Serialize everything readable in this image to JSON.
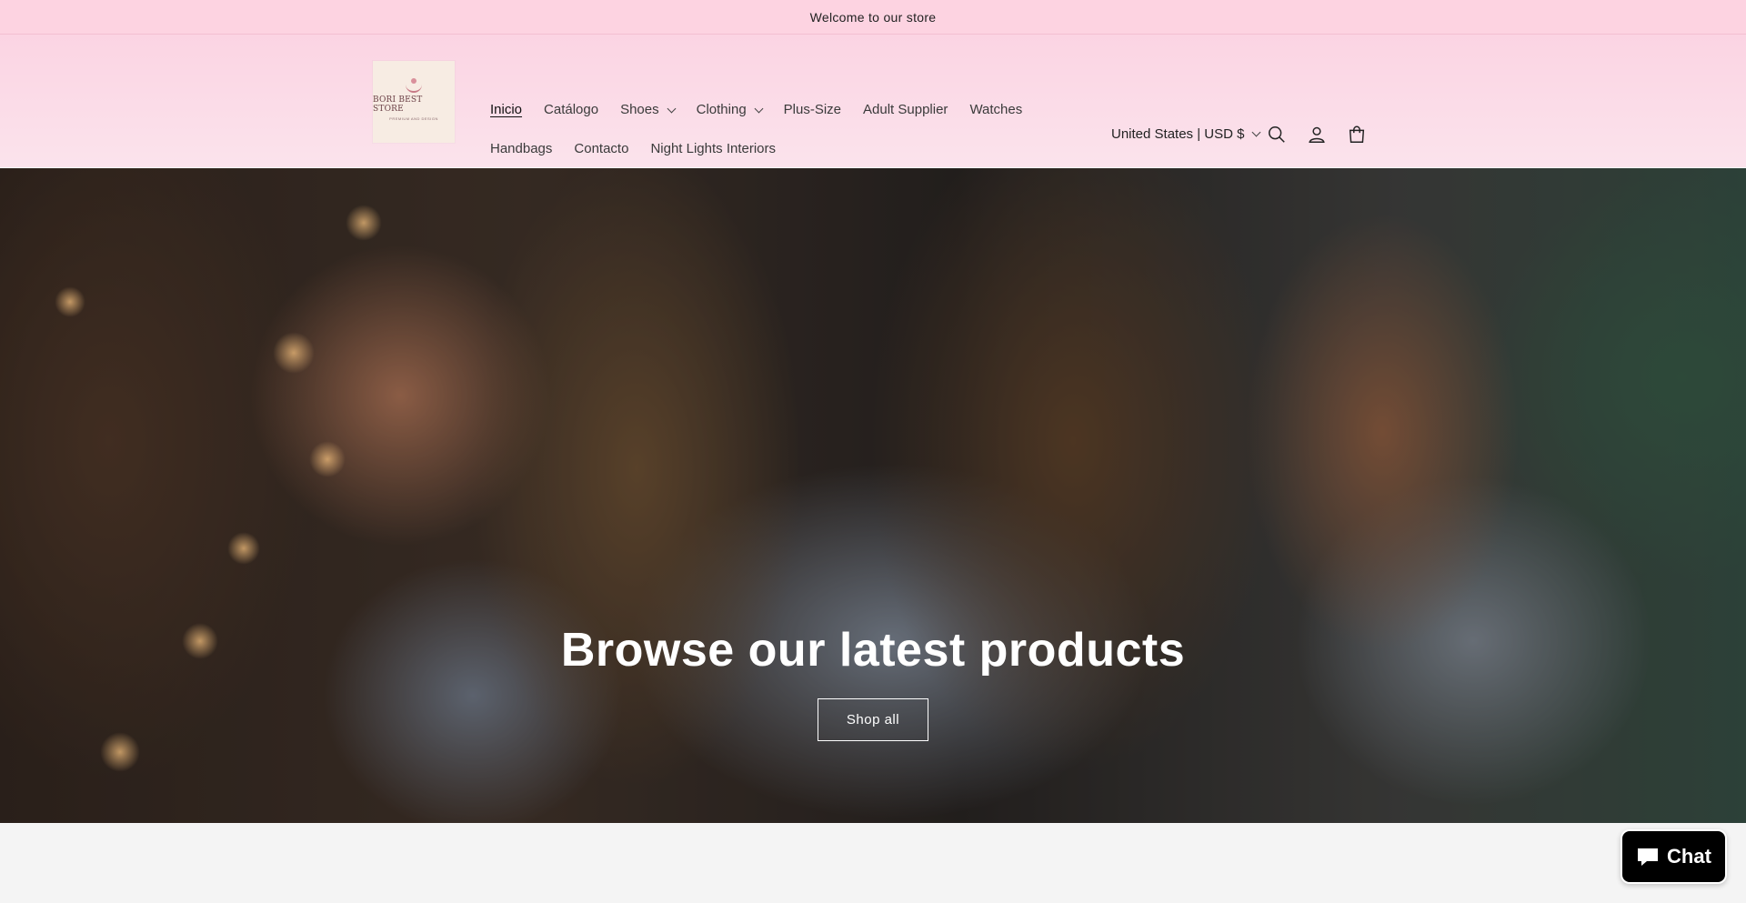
{
  "announcement": {
    "text": "Welcome to our store"
  },
  "logo": {
    "title": "BORI BEST STORE",
    "subtitle": "PREMIUM AND DESIGN"
  },
  "nav": {
    "row1": [
      {
        "label": "Inicio",
        "active": true,
        "dropdown": false
      },
      {
        "label": "Catálogo",
        "dropdown": false
      },
      {
        "label": "Shoes",
        "dropdown": true
      },
      {
        "label": "Clothing",
        "dropdown": true
      },
      {
        "label": "Plus-Size",
        "dropdown": false
      },
      {
        "label": "Adult Supplier",
        "dropdown": false
      },
      {
        "label": "Watches",
        "dropdown": false
      }
    ],
    "row2": [
      {
        "label": "Handbags"
      },
      {
        "label": "Contacto"
      },
      {
        "label": "Night Lights Interiors"
      }
    ]
  },
  "header": {
    "locale": "United States | USD $",
    "icons": [
      "search-icon",
      "account-icon",
      "cart-icon"
    ]
  },
  "hero": {
    "title": "Browse our latest products",
    "button": "Shop all"
  },
  "lower": {
    "text": ""
  },
  "chat": {
    "label": "Chat"
  },
  "colors": {
    "announcement_bg": "#fdd3e1",
    "header_bg": "#fbd4e3",
    "chat_bg": "#000000"
  }
}
